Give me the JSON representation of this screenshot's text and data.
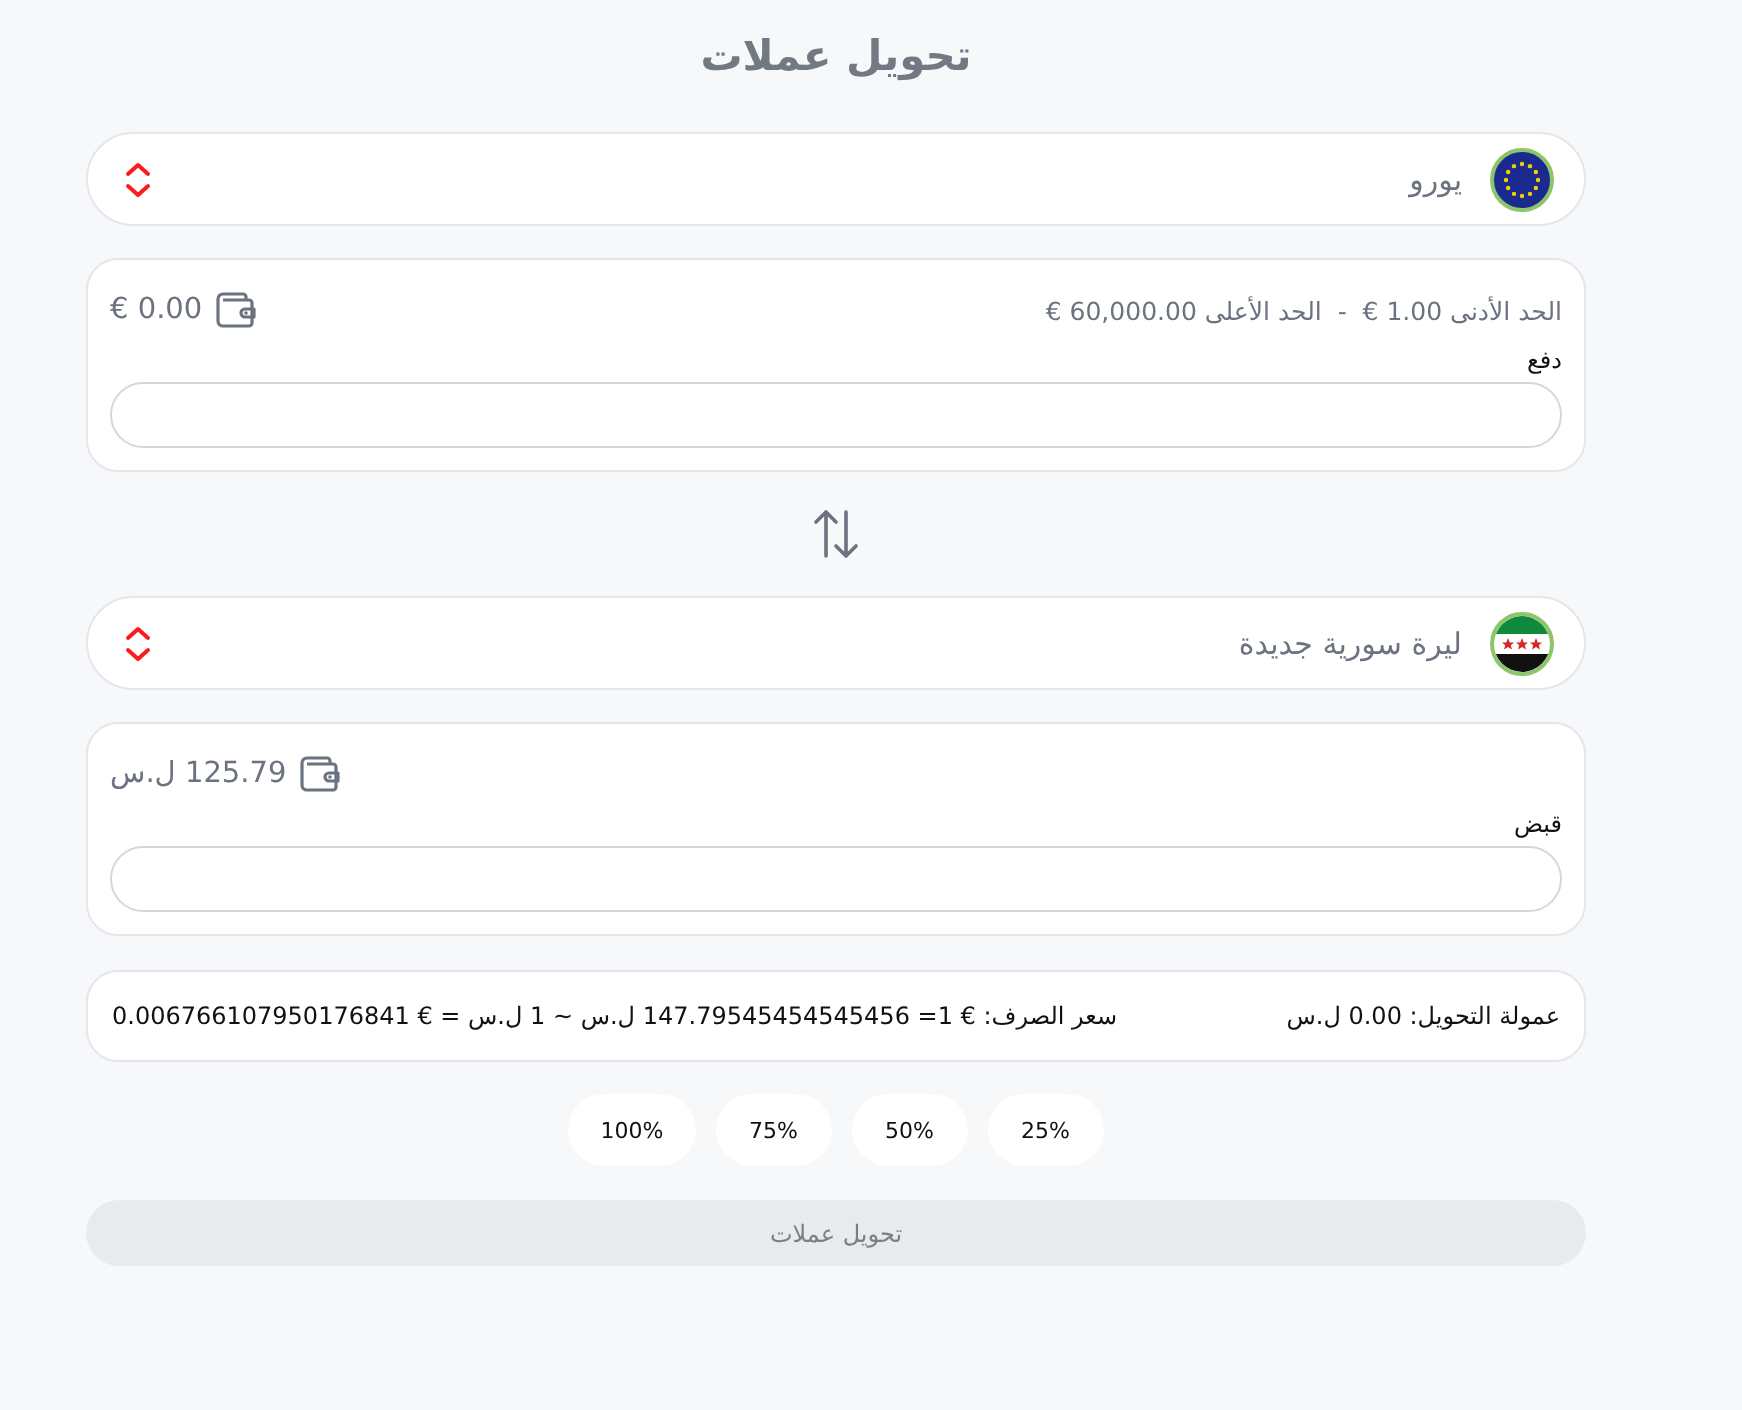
{
  "title": "تحويل عملات",
  "sides": [
    {
      "currency": "يورو",
      "limits": "الحد الأدنى 1.00 €  -  الحد الأعلى 60,000.00 €",
      "balance": "0.00 €",
      "field_label": "دفع"
    },
    {
      "currency": "ليرة سورية جديدة",
      "balance": "125.79 ل.س",
      "field_label": "قبض"
    }
  ],
  "info": {
    "commission": "عمولة التحويل: 0.00 ل.س",
    "rate": "سعر الصرف: € 1= 147.79545454545456 ل.س ~ 1 ل.س = € 0.006766107950176841"
  },
  "percent_buttons": [
    "25%",
    "50%",
    "75%",
    "100%"
  ],
  "submit_button": {
    "label": "تحويل عملات",
    "disabled": true
  }
}
